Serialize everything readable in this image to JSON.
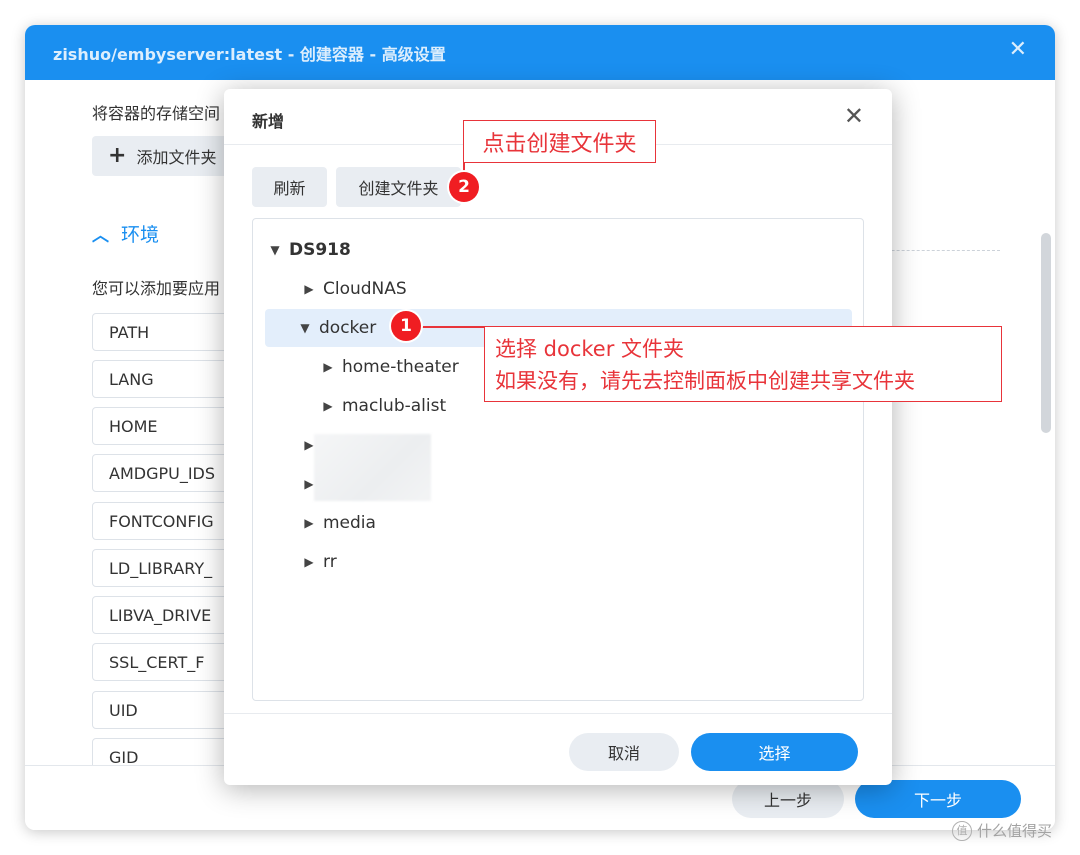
{
  "window": {
    "title": "zishuo/embyserver:latest - 创建容器 - 高级设置",
    "close_icon": "close-icon"
  },
  "storage": {
    "description": "将容器的存储空间",
    "add_folder_label": "添加文件夹"
  },
  "environment": {
    "section_title": "环境",
    "description": "您可以添加要应用",
    "variables": [
      "PATH",
      "LANG",
      "HOME",
      "AMDGPU_IDS",
      "FONTCONFIG",
      "LD_LIBRARY_",
      "LIBVA_DRIVE",
      "SSL_CERT_F",
      "UID",
      "GID"
    ]
  },
  "footer": {
    "prev_label": "上一步",
    "next_label": "下一步"
  },
  "dialog": {
    "title": "新增",
    "refresh_label": "刷新",
    "create_folder_label": "创建文件夹",
    "cancel_label": "取消",
    "select_label": "选择",
    "tree": {
      "root": "DS918",
      "nodes": [
        {
          "label": "CloudNAS",
          "expanded": false
        },
        {
          "label": "docker",
          "expanded": true,
          "selected": true
        },
        {
          "label": "home-theater",
          "expanded": false
        },
        {
          "label": "maclub-alist",
          "expanded": false
        },
        {
          "label": "",
          "expanded": false
        },
        {
          "label": "",
          "expanded": false
        },
        {
          "label": "media",
          "expanded": false
        },
        {
          "label": "rr",
          "expanded": false
        }
      ]
    }
  },
  "annotations": {
    "step1_badge": "1",
    "step2_badge": "2",
    "step2_callout": "点击创建文件夹",
    "step1_callout_line1": "选择 docker 文件夹",
    "step1_callout_line2": "如果没有，请先去控制面板中创建共享文件夹"
  },
  "watermark": {
    "text": "什么值得买",
    "icon_glyph": "值"
  },
  "colors": {
    "accent": "#1a8ff0",
    "annotation": "#e8343a",
    "badge": "#f01d22"
  }
}
